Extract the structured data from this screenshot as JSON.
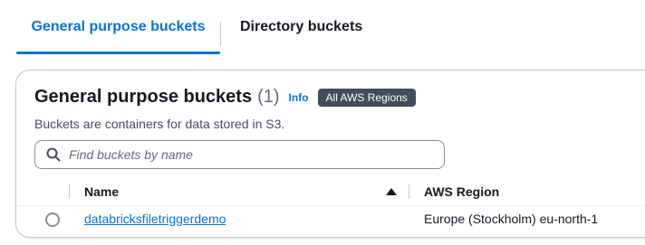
{
  "tabs": [
    {
      "label": "General purpose buckets",
      "active": true
    },
    {
      "label": "Directory buckets",
      "active": false
    }
  ],
  "panel": {
    "title": "General purpose buckets",
    "count": "(1)",
    "info_label": "Info",
    "region_badge": "All AWS Regions",
    "description": "Buckets are containers for data stored in S3."
  },
  "search": {
    "placeholder": "Find buckets by name",
    "value": ""
  },
  "table": {
    "columns": [
      {
        "label": "Name",
        "sort": "ascending"
      },
      {
        "label": "AWS Region"
      }
    ],
    "rows": [
      {
        "name": "databricksfiletriggerdemo",
        "region": "Europe (Stockholm) eu-north-1",
        "selected": false
      }
    ]
  },
  "colors": {
    "accent": "#0972d3",
    "badge_bg": "#414d5c",
    "border": "#c6c6cd"
  },
  "icons": {
    "search": "search-icon",
    "sort": "sort-ascending-icon",
    "radio": "radio-unchecked-icon"
  }
}
